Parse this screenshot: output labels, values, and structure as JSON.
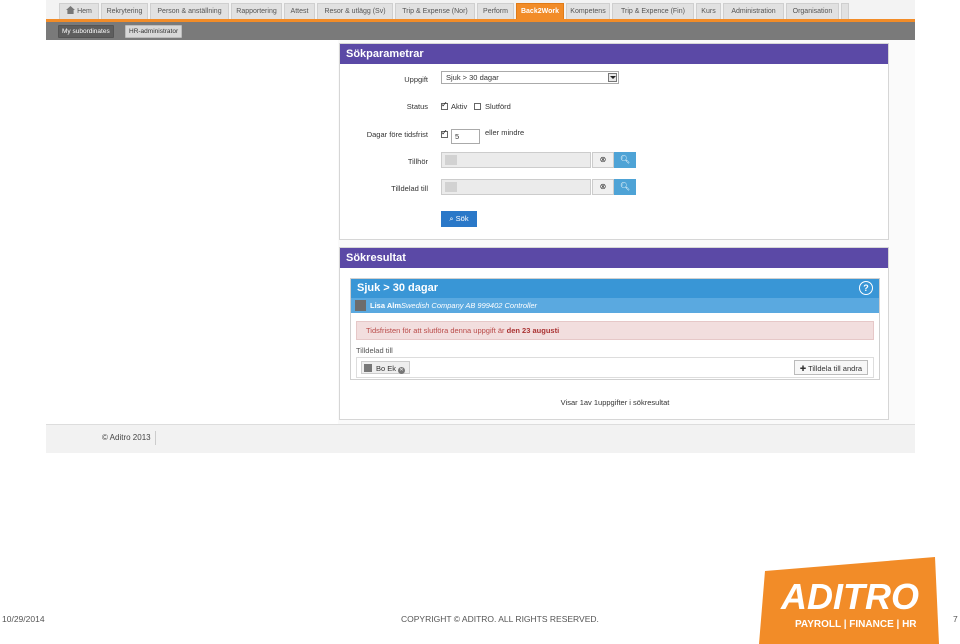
{
  "tabs": [
    {
      "label": "Hem",
      "active": false,
      "icon": "home-icon"
    },
    {
      "label": "Rekrytering",
      "active": false
    },
    {
      "label": "Person & anställning",
      "active": false
    },
    {
      "label": "Rapportering",
      "active": false
    },
    {
      "label": "Attest",
      "active": false
    },
    {
      "label": "Resor & utlägg (Sv)",
      "active": false
    },
    {
      "label": "Trip & Expense (Nor)",
      "active": false
    },
    {
      "label": "Perform",
      "active": false
    },
    {
      "label": "Back2Work",
      "active": true
    },
    {
      "label": "Kompetens",
      "active": false
    },
    {
      "label": "Trip & Expence (Fin)",
      "active": false
    },
    {
      "label": "Kurs",
      "active": false
    },
    {
      "label": "Administration",
      "active": false
    },
    {
      "label": "Organisation",
      "active": false
    }
  ],
  "subtabs": {
    "my_subordinates": "My subordinates",
    "hr_admin": "HR-administrator"
  },
  "search": {
    "title": "Sökparametrar",
    "task_label": "Uppgift",
    "task_value": "Sjuk > 30 dagar",
    "status_label": "Status",
    "status_active": "Aktiv",
    "status_done": "Slutförd",
    "days_label": "Dagar före tidsfrist",
    "days_value": "5",
    "days_suffix": "eller mindre",
    "belongs_label": "Tillhör",
    "assigned_label": "Tilldelad till",
    "search_button": "Sök"
  },
  "results": {
    "title": "Sökresultat",
    "card_title": "Sjuk > 30 dagar",
    "help": "?",
    "person_name": "Lisa Alm",
    "person_detail": "Swedish Company AB 999402 Controller",
    "alert_text": "Tidsfristen för att slutföra denna uppgift är ",
    "alert_date": "den 23 augusti",
    "assigned_label": "Tilldelad till",
    "assignee": "Bo Ek",
    "assign_button": "Tilldela till andra",
    "summary": "Visar 1av 1uppgifter i sökresultat"
  },
  "footer": {
    "copyright": "© Aditro 2013"
  },
  "slide": {
    "date": "10/29/2014",
    "copyright": "COPYRIGHT © ADITRO. ALL RIGHTS RESERVED.",
    "page": "7",
    "logo_text": "ADITRO",
    "logo_tagline": "PAYROLL | FINANCE | HR"
  },
  "colors": {
    "accent": "#f28c28",
    "panel_header": "#5b49a6",
    "card_header": "#3996d6",
    "primary_button": "#2a78c8"
  }
}
